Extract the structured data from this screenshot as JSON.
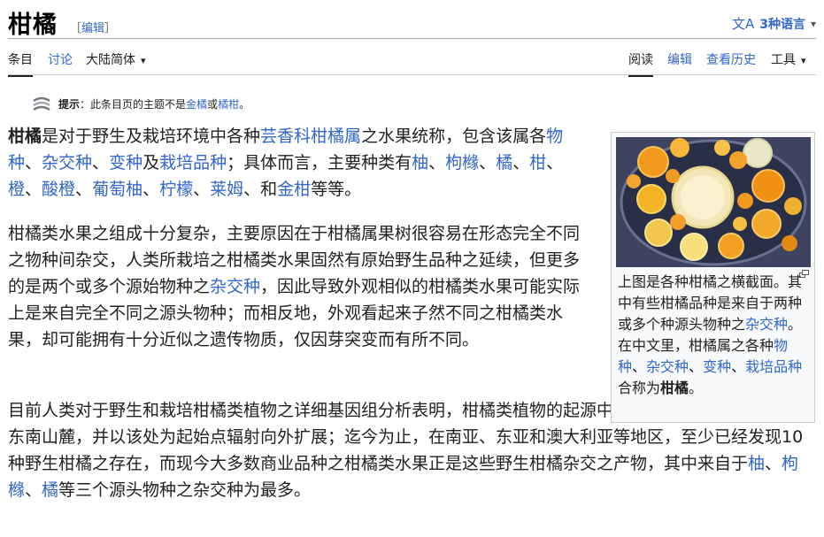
{
  "title": "柑橘",
  "edit_section": {
    "open": "［",
    "label": "编辑",
    "close": "］"
  },
  "language_button": {
    "icon": "文A",
    "label": "3种语言",
    "chevron": "⌄"
  },
  "tabs_left": [
    {
      "label": "条目",
      "selected": true
    },
    {
      "label": "讨论",
      "selected": false
    },
    {
      "label": "大陆简体",
      "chevron": "⌄"
    }
  ],
  "tabs_right": [
    {
      "label": "阅读",
      "selected": true
    },
    {
      "label": "编辑",
      "selected": false
    },
    {
      "label": "查看历史",
      "selected": false
    },
    {
      "label": "工具",
      "chevron": "⌄"
    }
  ],
  "hatnote": {
    "icon": "disambiguation-icon",
    "label": "提示",
    "text_a": "：此条目页的主题不是",
    "link_1": "金橘",
    "text_b": "或",
    "link_2": "橘柑",
    "text_c": "。"
  },
  "p1": {
    "bold": "柑橘",
    "t1": "是对于野生及栽培环境中各种",
    "l1": "芸香科",
    "l2": "柑橘属",
    "t2": "之水果统称，包含该属各",
    "l3": "物种",
    "t3": "、",
    "l4": "杂交种",
    "t4": "、",
    "l5": "变种",
    "t5": "及",
    "l6": "栽培品种",
    "t6": "；具体而言，主要种类有",
    "l7": "柚",
    "t7": "、",
    "l8": "枸橼",
    "t8": "、",
    "l9": "橘",
    "t9": "、",
    "l10": "柑",
    "t10": "、",
    "l11": "橙",
    "t11": "、",
    "l12": "酸橙",
    "t12": "、",
    "l13": "葡萄柚",
    "t13": "、",
    "l14": "柠檬",
    "t14": "、",
    "l15": "莱姆",
    "t15": "、和",
    "l16": "金柑",
    "t16": "等等。"
  },
  "p2": {
    "t1": "柑橘类水果之组成十分复杂，主要原因在于柑橘属果树很容易在形态完全不同之物种间杂交，人类所栽培之柑橘类水果固然有原始野生品种之延续，但更多的是两个或多个源始物种之",
    "l1": "杂交种",
    "t2": "，因此导致外观相似的柑橘类水果可能实际上是来自完全不同之源头物种；而相反地，外观看起来子然不同之柑橘类水果，却可能拥有十分近似之遗传物质，仅因芽突变而有所不同。"
  },
  "p3": {
    "t1": "目前人类对于野生和栽培柑橘类植物之详细基因组分析表明，柑橘类植物的起源中心可能是喜马拉雅山区的东南山麓，并以该处为起始点辐射向外扩展；迄今为止，在南亚、东亚和澳大利亚等地区，至少已经发现10种野生柑橘之存在，而现今大多数商业品种之柑橘类水果正是这些野生柑橘杂交之产物，其中来自于",
    "l1": "柚",
    "t2": "、",
    "l2": "枸橼",
    "t3": "、",
    "l3": "橘",
    "t4": "等三个源头物种之杂交种为最多。"
  },
  "infobox": {
    "image_alt": "各种柑橘之横截面",
    "magnify_icon": "magnify-icon",
    "caption1_a": "上图是各种柑橘之横截面。其中有些柑橘品种是来自于两种或多个种源头物种之",
    "caption1_link": "杂交种",
    "caption1_b": "。",
    "caption2_a": "在中文里，柑橘属之各种",
    "caption2_l1": "物种",
    "caption2_t1": "、",
    "caption2_l2": "杂交种",
    "caption2_t2": "、",
    "caption2_l3": "变种",
    "caption2_t3": "、",
    "caption2_l4": "栽培品种",
    "caption2_b": "合称为",
    "caption2_bold": "柑橘",
    "caption2_c": "。"
  },
  "colors": {
    "link": "#3366cc",
    "text": "#202122",
    "border": "#a2a9b1"
  }
}
